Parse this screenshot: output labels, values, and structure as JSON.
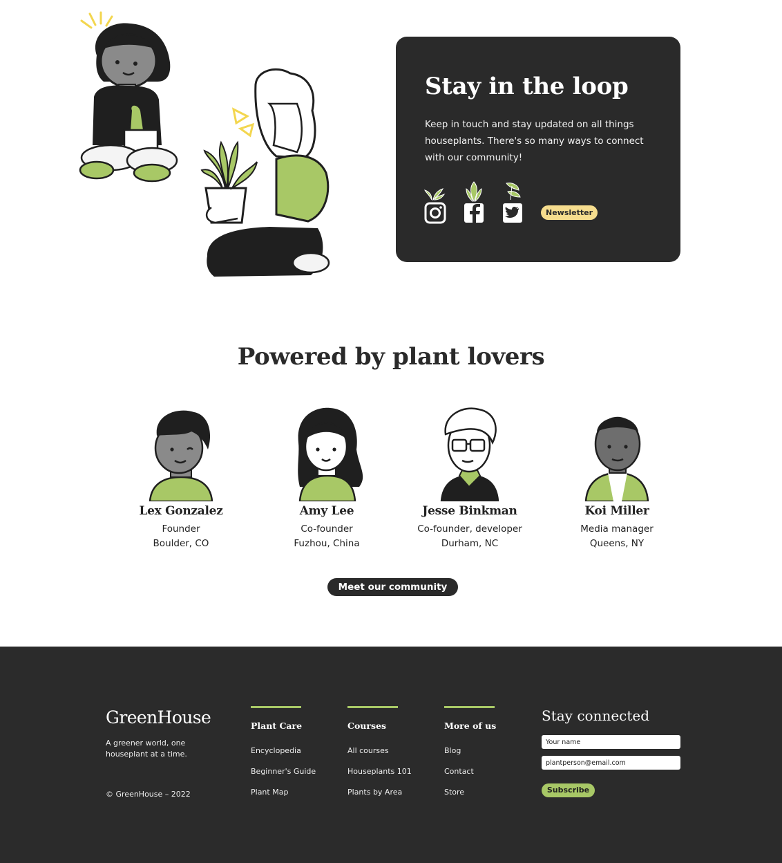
{
  "colors": {
    "dark": "#2a2a2a",
    "accent_green": "#a8c866",
    "newsletter_yellow": "#f6dd8e",
    "white": "#ffffff"
  },
  "loop": {
    "title": "Stay in the loop",
    "text": "Keep in touch and stay updated on all things houseplants. There's so many ways to connect with our community!",
    "social": [
      "instagram-icon",
      "facebook-icon",
      "twitter-icon"
    ],
    "newsletter_label": "Newsletter"
  },
  "team": {
    "title": "Powered by plant lovers",
    "members": [
      {
        "name": "Lex Gonzalez",
        "role": "Founder",
        "location": "Boulder, CO"
      },
      {
        "name": "Amy Lee",
        "role": "Co-founder",
        "location": "Fuzhou, China"
      },
      {
        "name": "Jesse Binkman",
        "role": "Co-founder, developer",
        "location": "Durham, NC"
      },
      {
        "name": "Koi Miller",
        "role": "Media manager",
        "location": "Queens, NY"
      }
    ],
    "cta_label": "Meet our community"
  },
  "footer": {
    "logo": "GreenHouse",
    "tagline": "A greener world, one houseplant at a time.",
    "copyright": "© GreenHouse – 2022",
    "columns": [
      {
        "heading": "Plant Care",
        "links": [
          "Encyclopedia",
          "Beginner's Guide",
          "Plant Map"
        ]
      },
      {
        "heading": "Courses",
        "links": [
          "All courses",
          "Houseplants 101",
          "Plants by Area"
        ]
      },
      {
        "heading": "More of us",
        "links": [
          "Blog",
          "Contact",
          "Store"
        ]
      }
    ],
    "connect": {
      "title": "Stay connected",
      "name_placeholder": "Your name",
      "email_placeholder": "plantperson@email.com",
      "subscribe_label": "Subscribe"
    }
  }
}
